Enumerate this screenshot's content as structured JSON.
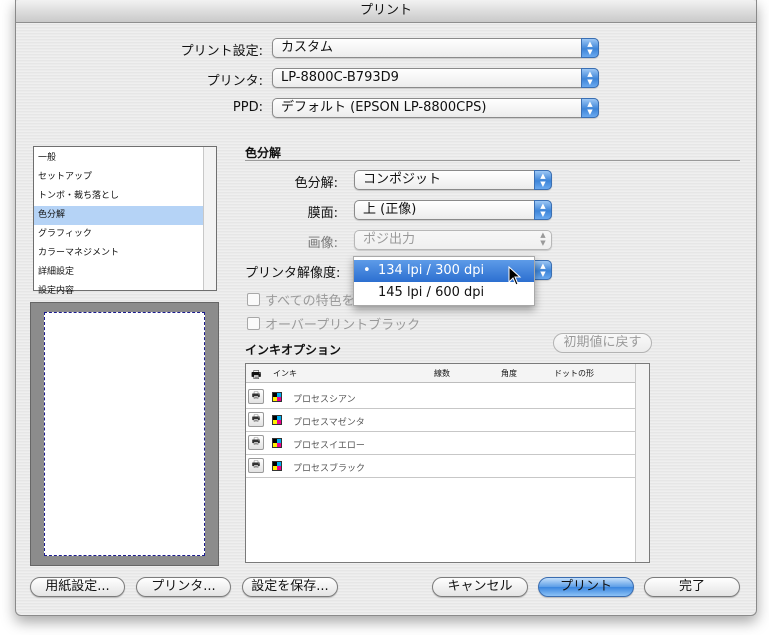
{
  "window": {
    "title": "プリント"
  },
  "top": {
    "preset": {
      "label": "プリント設定:",
      "value": "カスタム"
    },
    "printer": {
      "label": "プリンタ:",
      "value": "LP-8800C-B793D9"
    },
    "ppd": {
      "label": "PPD:",
      "value": "デフォルト (EPSON LP-8800CPS)"
    }
  },
  "categories": {
    "items": [
      "一般",
      "セットアップ",
      "トンボ・裁ち落とし",
      "色分解",
      "グラフィック",
      "カラーマネジメント",
      "詳細設定",
      "設定内容"
    ],
    "selected": "色分解"
  },
  "separation": {
    "section_title": "色分解",
    "mode": {
      "label": "色分解:",
      "value": "コンポジット"
    },
    "emulsion": {
      "label": "膜面:",
      "value": "上 (正像)"
    },
    "image": {
      "label": "画像:",
      "value": "ポジ出力"
    },
    "resolution": {
      "label": "プリンタ解像度:",
      "options": [
        "134 lpi / 300 dpi",
        "145 lpi / 600 dpi"
      ],
      "selected": "134 lpi / 300 dpi",
      "check_mark": "•"
    },
    "all_spot_checkbox": "すべての特色を",
    "overprint_checkbox": "オーバープリントブラック"
  },
  "ink": {
    "section_title": "インキオプション",
    "reset_button": "初期値に戻す",
    "columns": [
      "インキ",
      "線数",
      "角度",
      "ドットの形"
    ],
    "rows": [
      "プロセスシアン",
      "プロセスマゼンタ",
      "プロセスイエロー",
      "プロセスブラック"
    ]
  },
  "buttons": {
    "page_setup": "用紙設定...",
    "printer": "プリンタ...",
    "save_settings": "設定を保存...",
    "cancel": "キャンセル",
    "print": "プリント",
    "done": "完了"
  },
  "icons": {
    "printer": "🖶",
    "arrows_up": "▲",
    "arrows_down": "▼"
  }
}
